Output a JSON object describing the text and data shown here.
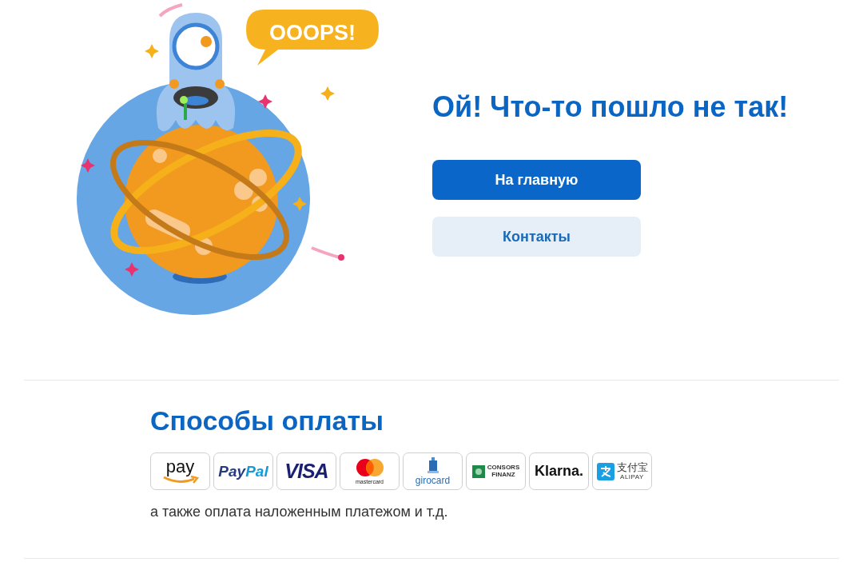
{
  "illustration": {
    "bubble_text": "OOOPS!"
  },
  "error": {
    "title": "Ой! Что-то пошло не так!"
  },
  "buttons": [
    {
      "label": "На главную",
      "kind": "primary"
    },
    {
      "label": "Контакты",
      "kind": "secondary"
    }
  ],
  "payment": {
    "title": "Способы оплаты",
    "methods": [
      {
        "kind": "amazon",
        "texts": [
          "pay"
        ]
      },
      {
        "kind": "paypal",
        "texts": [
          "Pay",
          "Pal"
        ]
      },
      {
        "kind": "visa",
        "texts": [
          "VISA"
        ]
      },
      {
        "kind": "mastercard",
        "texts": [
          "mastercard"
        ]
      },
      {
        "kind": "girocard",
        "texts": [
          "girocard"
        ]
      },
      {
        "kind": "consors",
        "texts": [
          "CONSORS",
          "FINANZ"
        ]
      },
      {
        "kind": "klarna",
        "texts": [
          "Klarna."
        ]
      },
      {
        "kind": "alipay",
        "texts": [
          "支付宝",
          "ALIPAY"
        ]
      }
    ],
    "note": "а также оплата наложенным платежом и т.д."
  }
}
